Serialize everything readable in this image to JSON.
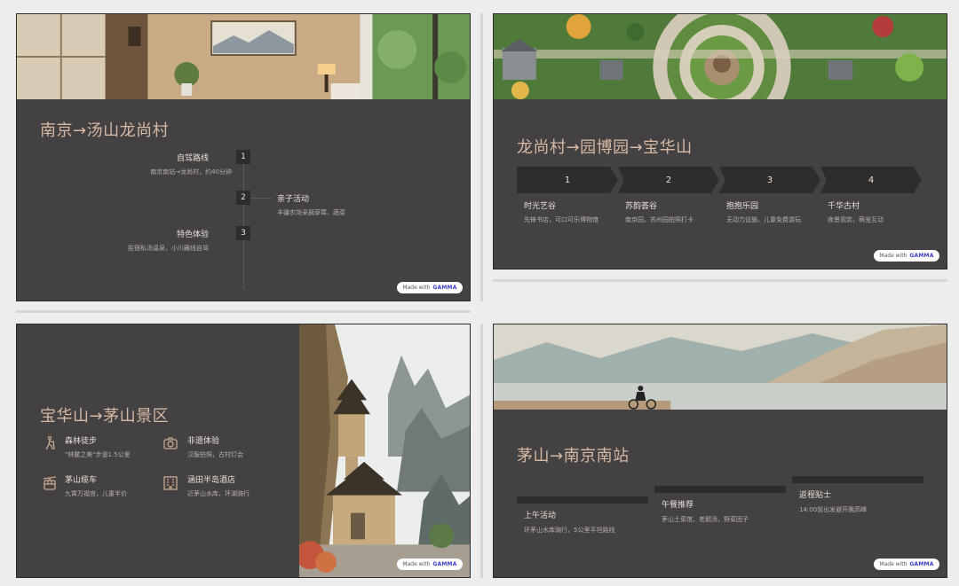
{
  "slides": {
    "s1": {
      "title": "南京→汤山龙尚村",
      "items": [
        {
          "num": "1",
          "label": "自驾路线",
          "sub": "南京南站→龙尚村，约40分钟"
        },
        {
          "num": "2",
          "label": "亲子活动",
          "sub": "丰疆农场采摘草莓、蔬菜"
        },
        {
          "num": "3",
          "label": "特色体验",
          "sub": "民宿私汤温泉，小川藏线自驾"
        }
      ]
    },
    "s2": {
      "title": "龙尚村→园博园→宝华山",
      "steps": [
        {
          "num": "1",
          "label": "时光艺谷",
          "sub": "先锋书店，可口可乐博物馆"
        },
        {
          "num": "2",
          "label": "苏韵荟谷",
          "sub": "南京园，苏州园拍照打卡"
        },
        {
          "num": "3",
          "label": "抱抱乐园",
          "sub": "无动力设施，儿童免费游玩"
        },
        {
          "num": "4",
          "label": "千华古村",
          "sub": "夜景观赏，萌宠互动"
        }
      ]
    },
    "s3": {
      "title": "宝华山→茅山景区",
      "features": [
        {
          "label": "森林徒步",
          "sub": "\"林麓之美\"步道1.5公里",
          "icon": "hiking-icon"
        },
        {
          "label": "非遗体验",
          "sub": "汉服拍照，古村灯会",
          "icon": "camera-icon"
        },
        {
          "label": "茅山缆车",
          "sub": "九霄万福宫，儿童半价",
          "icon": "cable-car-icon"
        },
        {
          "label": "涵田半岛酒店",
          "sub": "近茅山水库，环湖骑行",
          "icon": "hotel-icon"
        }
      ]
    },
    "s4": {
      "title": "茅山→南京南站",
      "cards": [
        {
          "label": "上午活动",
          "sub": "环茅山水库骑行，5公里平坦路线"
        },
        {
          "label": "午餐推荐",
          "sub": "茅山土菜馆，老鹅汤，野菜团子"
        },
        {
          "label": "返程贴士",
          "sub": "14:00前出发避开晚高峰"
        }
      ]
    }
  },
  "badge": {
    "prefix": "Made with",
    "brand": "GAMMA"
  },
  "colors": {
    "slide_bg": "#434141",
    "title": "#d7b9a4",
    "accent_dark": "#2f2d2c"
  }
}
